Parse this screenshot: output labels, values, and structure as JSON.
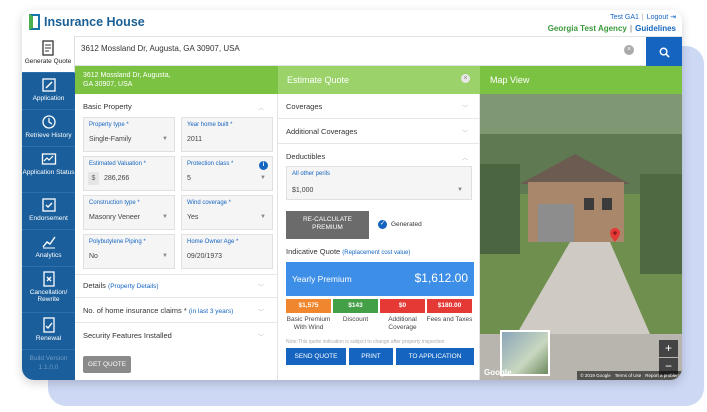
{
  "app": {
    "logo_text": "Insurance House"
  },
  "header": {
    "user": "Test GA1",
    "logout": "Logout",
    "agency": "Georgia Test Agency",
    "guidelines": "Guidelines"
  },
  "sidebar": {
    "items": [
      {
        "label": "Generate Quote",
        "icon": "document-icon"
      },
      {
        "label": "Application",
        "icon": "edit-icon"
      },
      {
        "label": "Retrieve History",
        "icon": "history-icon"
      },
      {
        "label": "Application Status",
        "icon": "status-icon"
      },
      {
        "label": "Endorsement",
        "icon": "endorsement-icon"
      },
      {
        "label": "Analytics",
        "icon": "analytics-icon"
      },
      {
        "label": "Cancellation/ Rewrite",
        "icon": "cancellation-icon"
      },
      {
        "label": "Renewal",
        "icon": "renewal-icon"
      }
    ],
    "version_label": "Build Version",
    "version_value": "1.1.0.0"
  },
  "search": {
    "value": "3612 Mossland Dr, Augusta, GA 30907, USA"
  },
  "panels": {
    "left_header_line1": "3612 Mossland Dr, Augusta,",
    "left_header_line2": "GA 30907, USA",
    "estimate_title": "Estimate Quote",
    "map_title": "Map View"
  },
  "basic_property": {
    "title": "Basic Property",
    "fields": [
      {
        "label": "Property type *",
        "value": "Single-Family"
      },
      {
        "label": "Year home built *",
        "value": "2011"
      },
      {
        "label": "Estimated Valuation *",
        "value": "286,266",
        "prefix": "$"
      },
      {
        "label": "Protection class *",
        "value": "5"
      },
      {
        "label": "Construction type *",
        "value": "Masonry Veneer"
      },
      {
        "label": "Wind coverage *",
        "value": "Yes"
      },
      {
        "label": "Polybutylene Piping *",
        "value": "No"
      },
      {
        "label": "Home Owner Age *",
        "value": "09/20/1973"
      }
    ]
  },
  "details": {
    "title": "Details",
    "link": "(Property Details)"
  },
  "claims": {
    "title": "No. of home insurance claims *",
    "link": "(in last 3 years)"
  },
  "security": {
    "title": "Security Features Installed"
  },
  "get_quote": "GET QUOTE",
  "estimate": {
    "coverages": "Coverages",
    "additional_coverages": "Additional Coverages",
    "deductibles": "Deductibles",
    "peril_label": "All other perils",
    "peril_value": "$1,000",
    "recalc_line1": "RE-CALCULATE",
    "recalc_line2": "PREMIUM",
    "generated": "Generated",
    "indicative_title": "Indicative Quote",
    "indicative_sub": "(Replacement cost value)",
    "yearly_label": "Yearly Premium",
    "yearly_value": "$1,612.00",
    "breakdown": [
      {
        "value": "$1,575",
        "caption": "Basic Premium With Wind",
        "color": "#f0862e"
      },
      {
        "value": "$143",
        "caption": "Discount",
        "color": "#43a047"
      },
      {
        "value": "$0",
        "caption": "Additional Coverage",
        "color": "#e53935"
      },
      {
        "value": "$180.00",
        "caption": "Fees and Taxes",
        "color": "#e53935"
      }
    ],
    "note": "Note:This quote indication is subject to change after property inspection",
    "send_quote": "SEND QUOTE",
    "print": "PRINT",
    "to_application": "TO APPLICATION"
  },
  "map": {
    "zoom_in": "+",
    "zoom_out": "−",
    "google": "Google",
    "footer": [
      "© 2019 Google",
      "Terms of Use",
      "Report a problem"
    ]
  }
}
